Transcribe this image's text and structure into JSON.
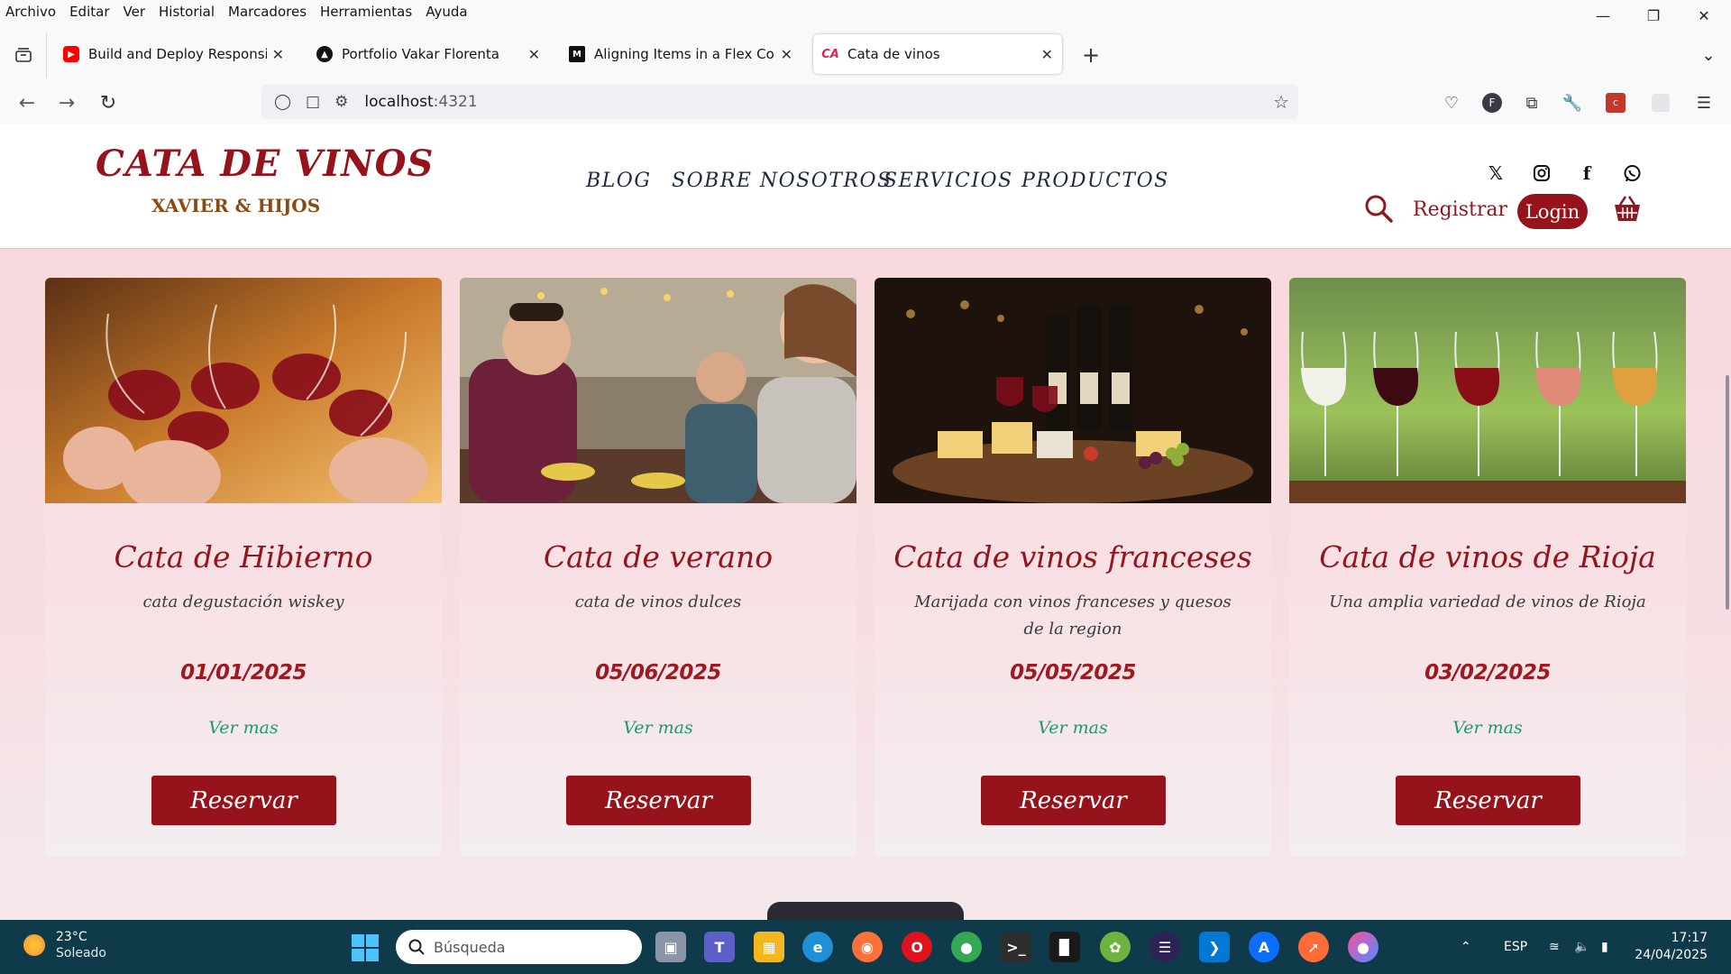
{
  "menubar": [
    "Archivo",
    "Editar",
    "Ver",
    "Historial",
    "Marcadores",
    "Herramientas",
    "Ayuda"
  ],
  "window": {
    "minimize_icon": "minimize-icon",
    "restore_icon": "restore-icon",
    "close_icon": "close-icon"
  },
  "tabs": [
    {
      "title": "Build and Deploy Responsive Re",
      "favicon": "youtube",
      "color": "#ff0000"
    },
    {
      "title": "Portfolio Vakar Florenta",
      "favicon": "triangle",
      "color": "#111111"
    },
    {
      "title": "Aligning Items in a Flex Contain",
      "favicon": "mdn",
      "color": "#111111"
    },
    {
      "title": "Cata de vinos",
      "favicon": "cata",
      "color": "#e0245e"
    }
  ],
  "urlbar": {
    "host": "localhost",
    "port": ":4321"
  },
  "site": {
    "logo_main": "CATA DE VINOS",
    "logo_sub": "XAVIER & HIJOS",
    "nav": [
      "BLOG",
      "SOBRE NOSOTROS",
      "SERVICIOS",
      "PRODUCTOS"
    ],
    "social": [
      "x-icon",
      "instagram-icon",
      "facebook-icon",
      "whatsapp-icon"
    ],
    "registrar": "Registrar",
    "login": "Login",
    "accent": "#97131c"
  },
  "cards": [
    {
      "title": "Cata de Hibierno",
      "desc": "cata degustación wiskey",
      "date": "01/01/2025",
      "more": "Ver mas",
      "button": "Reservar",
      "image": "toasting wine glasses"
    },
    {
      "title": "Cata de verano",
      "desc": "cata de vinos dulces",
      "date": "05/06/2025",
      "more": "Ver mas",
      "button": "Reservar",
      "image": "friends dining"
    },
    {
      "title": "Cata de vinos franceses",
      "desc": "Marijada con vinos franceses y quesos de la region",
      "date": "05/05/2025",
      "more": "Ver mas",
      "button": "Reservar",
      "image": "wine and cheese board"
    },
    {
      "title": "Cata de vinos de Rioja",
      "desc": "Una amplia variedad de vinos de Rioja",
      "date": "03/02/2025",
      "more": "Ver mas",
      "button": "Reservar",
      "image": "wine glasses in vineyard"
    }
  ],
  "taskbar": {
    "temp": "23°C",
    "weather": "Soleado",
    "search_placeholder": "Búsqueda",
    "lang": "ESP",
    "time": "17:17",
    "date": "24/04/2025"
  }
}
